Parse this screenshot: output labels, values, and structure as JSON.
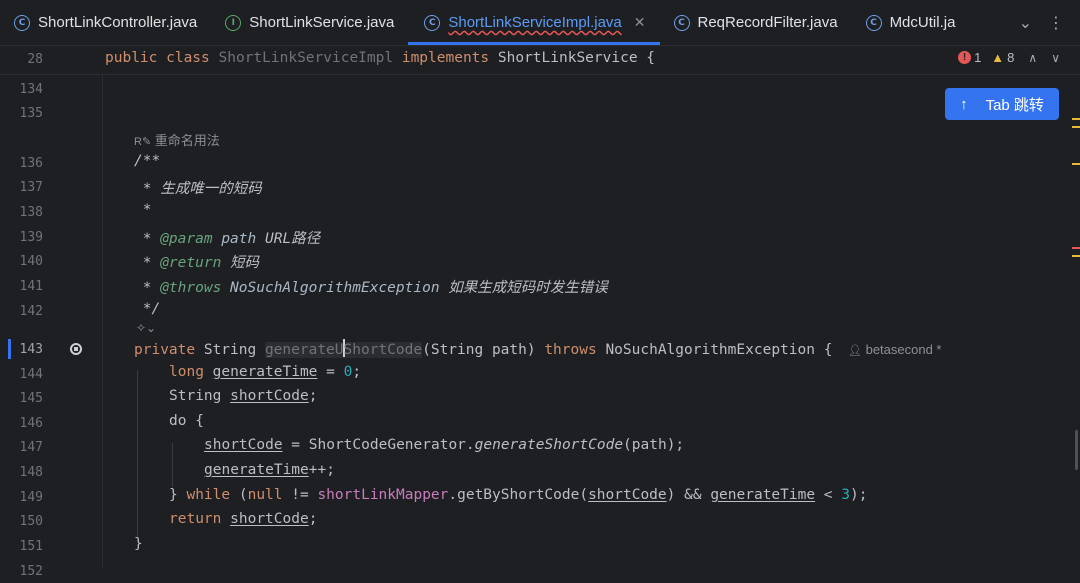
{
  "tabs": [
    {
      "label": "ShortLinkController.java",
      "icon": "class-icon",
      "active": false
    },
    {
      "label": "ShortLinkService.java",
      "icon": "interface-icon",
      "active": false
    },
    {
      "label": "ShortLinkServiceImpl.java",
      "icon": "class-icon",
      "active": true
    },
    {
      "label": "ReqRecordFilter.java",
      "icon": "class-icon",
      "active": false
    },
    {
      "label": "MdcUtil.ja",
      "icon": "class-icon",
      "active": false
    }
  ],
  "sticky": {
    "line_no": "28",
    "kw1": "public class ",
    "name": "ShortLinkServiceImpl",
    "kw2": " implements ",
    "iface": "ShortLinkService {"
  },
  "inspections": {
    "errors": "1",
    "warnings": "8"
  },
  "hints": {
    "rename": "重命名用法",
    "author": "betasecond *"
  },
  "tab_button": {
    "label": "Tab 跳转"
  },
  "lines": {
    "n134": "134",
    "n135": "135",
    "n136": "136",
    "n137": "137",
    "n138": "138",
    "n139": "139",
    "n140": "140",
    "n141": "141",
    "n142": "142",
    "n143": "143",
    "n144": "144",
    "n145": "145",
    "n146": "146",
    "n147": "147",
    "n148": "148",
    "n149": "149",
    "n150": "150",
    "n151": "151",
    "n152": "152"
  },
  "code": {
    "l136": "/**",
    "l137": " * 生成唯一的短码",
    "l138": " *",
    "l139_a": " * ",
    "l139_tag": "@param",
    "l139_p": " path",
    "l139_rest": " URL路径",
    "l140_a": " * ",
    "l140_tag": "@return",
    "l140_rest": " 短码",
    "l141_a": " * ",
    "l141_tag": "@throws",
    "l141_ex": " NoSuchAlgorithmException",
    "l141_rest": " 如果生成短码时发生错误",
    "l142": " */",
    "l143_kw": "private",
    "l143_type": " String ",
    "l143_name_a": "generateU",
    "l143_name_b": "ShortCode",
    "l143_params": "(String path) ",
    "l143_throws": "throws",
    "l143_rest": " NoSuchAlgorithmException {",
    "l144_kw": "long",
    "l144_var": "generateTime",
    "l144_eq": " = ",
    "l144_num": "0",
    "l144_end": ";",
    "l145_type": "String ",
    "l145_var": "shortCode",
    "l145_end": ";",
    "l146": "do {",
    "l147_var": "shortCode",
    "l147_mid": " = ShortCodeGenerator.",
    "l147_m": "generateShortCode",
    "l147_end": "(path);",
    "l148_var": "generateTime",
    "l148_end": "++;",
    "l149_a": "} ",
    "l149_kw": "while",
    "l149_b": " (",
    "l149_null": "null",
    "l149_c": " != ",
    "l149_fld": "shortLinkMapper",
    "l149_d": ".getByShortCode(",
    "l149_v1": "shortCode",
    "l149_e": ") && ",
    "l149_v2": "generateTime",
    "l149_f": " < ",
    "l149_num": "3",
    "l149_g": ");",
    "l150_kw": "return",
    "l150_var": "shortCode",
    "l150_end": ";",
    "l151": "}"
  },
  "colors": {
    "accent": "#3574f0",
    "error": "#e55757",
    "warning": "#e8b93c"
  }
}
